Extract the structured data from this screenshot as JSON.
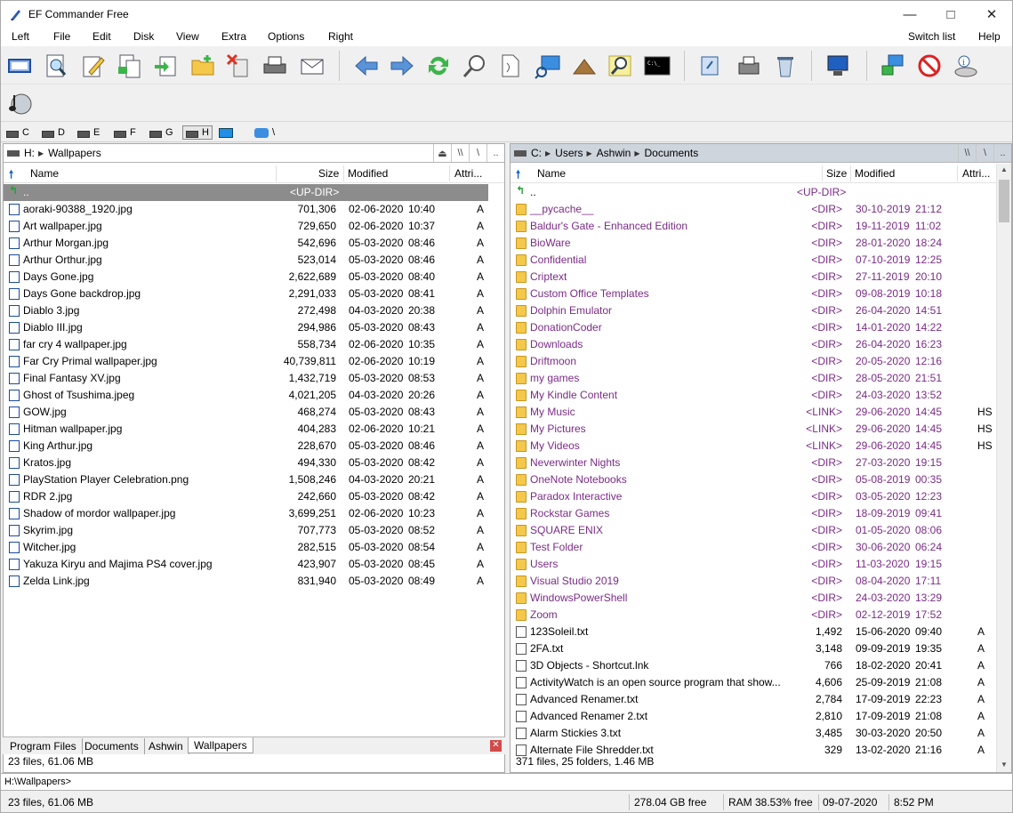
{
  "window": {
    "title": "EF Commander Free"
  },
  "menu": [
    "Left",
    "File",
    "Edit",
    "Disk",
    "View",
    "Extra",
    "Options",
    "Right",
    "Switch list",
    "Help"
  ],
  "toolbar_icons": [
    "panel-view-icon",
    "search-files-icon",
    "edit-icon",
    "copy-icon",
    "move-icon",
    "new-folder-icon",
    "delete-icon",
    "print-icon",
    "mail-icon",
    "back-icon",
    "forward-icon",
    "refresh-icon",
    "find-icon",
    "compare-icon",
    "remote-icon",
    "pyramid-icon",
    "search-icon",
    "terminal-icon",
    "notes-icon",
    "fax-icon",
    "recycle-bin-icon",
    "monitor-icon",
    "network-icon",
    "block-icon",
    "disk-info-icon",
    "music-player-icon"
  ],
  "drives": [
    {
      "letter": "C"
    },
    {
      "letter": "D"
    },
    {
      "letter": "E"
    },
    {
      "letter": "F"
    },
    {
      "letter": "G"
    },
    {
      "letter": "H"
    }
  ],
  "drive_extra": "\\",
  "left_pane": {
    "path": [
      "H:",
      "Wallpapers"
    ],
    "path_buttons": [
      "\\\\",
      "\\",
      ".."
    ],
    "columns": {
      "name": "Name",
      "size": "Size",
      "modified": "Modified",
      "attr": "Attri..."
    },
    "updir": {
      "name": "..",
      "size": "<UP-DIR>"
    },
    "rows": [
      {
        "name": "aoraki-90388_1920.jpg",
        "size": "701,306",
        "date": "02-06-2020",
        "time": "10:40",
        "attr": "A"
      },
      {
        "name": "Art wallpaper.jpg",
        "size": "729,650",
        "date": "02-06-2020",
        "time": "10:37",
        "attr": "A"
      },
      {
        "name": "Arthur Morgan.jpg",
        "size": "542,696",
        "date": "05-03-2020",
        "time": "08:46",
        "attr": "A"
      },
      {
        "name": "Arthur Orthur.jpg",
        "size": "523,014",
        "date": "05-03-2020",
        "time": "08:46",
        "attr": "A"
      },
      {
        "name": "Days Gone.jpg",
        "size": "2,622,689",
        "date": "05-03-2020",
        "time": "08:40",
        "attr": "A"
      },
      {
        "name": "Days Gone backdrop.jpg",
        "size": "2,291,033",
        "date": "05-03-2020",
        "time": "08:41",
        "attr": "A"
      },
      {
        "name": "Diablo 3.jpg",
        "size": "272,498",
        "date": "04-03-2020",
        "time": "20:38",
        "attr": "A"
      },
      {
        "name": "Diablo III.jpg",
        "size": "294,986",
        "date": "05-03-2020",
        "time": "08:43",
        "attr": "A"
      },
      {
        "name": "far cry 4 wallpaper.jpg",
        "size": "558,734",
        "date": "02-06-2020",
        "time": "10:35",
        "attr": "A"
      },
      {
        "name": "Far Cry Primal wallpaper.jpg",
        "size": "40,739,811",
        "date": "02-06-2020",
        "time": "10:19",
        "attr": "A"
      },
      {
        "name": "Final Fantasy XV.jpg",
        "size": "1,432,719",
        "date": "05-03-2020",
        "time": "08:53",
        "attr": "A"
      },
      {
        "name": "Ghost of Tsushima.jpeg",
        "size": "4,021,205",
        "date": "04-03-2020",
        "time": "20:26",
        "attr": "A"
      },
      {
        "name": "GOW.jpg",
        "size": "468,274",
        "date": "05-03-2020",
        "time": "08:43",
        "attr": "A"
      },
      {
        "name": "Hitman wallpaper.jpg",
        "size": "404,283",
        "date": "02-06-2020",
        "time": "10:21",
        "attr": "A"
      },
      {
        "name": "King Arthur.jpg",
        "size": "228,670",
        "date": "05-03-2020",
        "time": "08:46",
        "attr": "A"
      },
      {
        "name": "Kratos.jpg",
        "size": "494,330",
        "date": "05-03-2020",
        "time": "08:42",
        "attr": "A"
      },
      {
        "name": "PlayStation Player Celebration.png",
        "size": "1,508,246",
        "date": "04-03-2020",
        "time": "20:21",
        "attr": "A"
      },
      {
        "name": "RDR 2.jpg",
        "size": "242,660",
        "date": "05-03-2020",
        "time": "08:42",
        "attr": "A"
      },
      {
        "name": "Shadow of mordor wallpaper.jpg",
        "size": "3,699,251",
        "date": "02-06-2020",
        "time": "10:23",
        "attr": "A"
      },
      {
        "name": "Skyrim.jpg",
        "size": "707,773",
        "date": "05-03-2020",
        "time": "08:52",
        "attr": "A"
      },
      {
        "name": "Witcher.jpg",
        "size": "282,515",
        "date": "05-03-2020",
        "time": "08:54",
        "attr": "A"
      },
      {
        "name": "Yakuza Kiryu and Majima PS4 cover.jpg",
        "size": "423,907",
        "date": "05-03-2020",
        "time": "08:45",
        "attr": "A"
      },
      {
        "name": "Zelda Link.jpg",
        "size": "831,940",
        "date": "05-03-2020",
        "time": "08:49",
        "attr": "A"
      }
    ],
    "tabs": [
      "Program Files",
      "Documents",
      "Ashwin",
      "Wallpapers"
    ],
    "active_tab": "Wallpapers",
    "status": "23 files, 61.06 MB"
  },
  "right_pane": {
    "path": [
      "C:",
      "Users",
      "Ashwin",
      "Documents"
    ],
    "path_buttons": [
      "\\\\",
      "\\",
      ".."
    ],
    "columns": {
      "name": "Name",
      "size": "Size",
      "modified": "Modified",
      "attr": "Attri..."
    },
    "updir": {
      "name": "..",
      "size": "<UP-DIR>"
    },
    "rows": [
      {
        "type": "folder",
        "name": "__pycache__",
        "size": "<DIR>",
        "date": "30-10-2019",
        "time": "21:12",
        "attr": ""
      },
      {
        "type": "folder",
        "name": "Baldur's Gate - Enhanced Edition",
        "size": "<DIR>",
        "date": "19-11-2019",
        "time": "11:02",
        "attr": ""
      },
      {
        "type": "folder",
        "name": "BioWare",
        "size": "<DIR>",
        "date": "28-01-2020",
        "time": "18:24",
        "attr": ""
      },
      {
        "type": "folder",
        "name": "Confidential",
        "size": "<DIR>",
        "date": "07-10-2019",
        "time": "12:25",
        "attr": ""
      },
      {
        "type": "folder",
        "name": "Criptext",
        "size": "<DIR>",
        "date": "27-11-2019",
        "time": "20:10",
        "attr": ""
      },
      {
        "type": "folder",
        "name": "Custom Office Templates",
        "size": "<DIR>",
        "date": "09-08-2019",
        "time": "10:18",
        "attr": ""
      },
      {
        "type": "folder",
        "name": "Dolphin Emulator",
        "size": "<DIR>",
        "date": "26-04-2020",
        "time": "14:51",
        "attr": ""
      },
      {
        "type": "folder",
        "name": "DonationCoder",
        "size": "<DIR>",
        "date": "14-01-2020",
        "time": "14:22",
        "attr": ""
      },
      {
        "type": "folder",
        "name": "Downloads",
        "size": "<DIR>",
        "date": "26-04-2020",
        "time": "16:23",
        "attr": ""
      },
      {
        "type": "folder",
        "name": "Driftmoon",
        "size": "<DIR>",
        "date": "20-05-2020",
        "time": "12:16",
        "attr": ""
      },
      {
        "type": "folder",
        "name": "my games",
        "size": "<DIR>",
        "date": "28-05-2020",
        "time": "21:51",
        "attr": ""
      },
      {
        "type": "folder",
        "name": "My Kindle Content",
        "size": "<DIR>",
        "date": "24-03-2020",
        "time": "13:52",
        "attr": ""
      },
      {
        "type": "link",
        "name": "My Music",
        "size": "<LINK>",
        "date": "29-06-2020",
        "time": "14:45",
        "attr": "HS"
      },
      {
        "type": "link",
        "name": "My Pictures",
        "size": "<LINK>",
        "date": "29-06-2020",
        "time": "14:45",
        "attr": "HS"
      },
      {
        "type": "link",
        "name": "My Videos",
        "size": "<LINK>",
        "date": "29-06-2020",
        "time": "14:45",
        "attr": "HS"
      },
      {
        "type": "folder",
        "name": "Neverwinter Nights",
        "size": "<DIR>",
        "date": "27-03-2020",
        "time": "19:15",
        "attr": ""
      },
      {
        "type": "folder",
        "name": "OneNote Notebooks",
        "size": "<DIR>",
        "date": "05-08-2019",
        "time": "00:35",
        "attr": ""
      },
      {
        "type": "folder",
        "name": "Paradox Interactive",
        "size": "<DIR>",
        "date": "03-05-2020",
        "time": "12:23",
        "attr": ""
      },
      {
        "type": "folder",
        "name": "Rockstar Games",
        "size": "<DIR>",
        "date": "18-09-2019",
        "time": "09:41",
        "attr": ""
      },
      {
        "type": "folder",
        "name": "SQUARE ENIX",
        "size": "<DIR>",
        "date": "01-05-2020",
        "time": "08:06",
        "attr": ""
      },
      {
        "type": "folder",
        "name": "Test Folder",
        "size": "<DIR>",
        "date": "30-06-2020",
        "time": "06:24",
        "attr": ""
      },
      {
        "type": "folder",
        "name": "Users",
        "size": "<DIR>",
        "date": "11-03-2020",
        "time": "19:15",
        "attr": ""
      },
      {
        "type": "folder",
        "name": "Visual Studio 2019",
        "size": "<DIR>",
        "date": "08-04-2020",
        "time": "17:11",
        "attr": ""
      },
      {
        "type": "folder",
        "name": "WindowsPowerShell",
        "size": "<DIR>",
        "date": "24-03-2020",
        "time": "13:29",
        "attr": ""
      },
      {
        "type": "folder",
        "name": "Zoom",
        "size": "<DIR>",
        "date": "02-12-2019",
        "time": "17:52",
        "attr": ""
      },
      {
        "type": "file",
        "name": "123Soleil.txt",
        "size": "1,492",
        "date": "15-06-2020",
        "time": "09:40",
        "attr": "A"
      },
      {
        "type": "file",
        "name": "2FA.txt",
        "size": "3,148",
        "date": "09-09-2019",
        "time": "19:35",
        "attr": "A"
      },
      {
        "type": "file",
        "name": "3D Objects - Shortcut.lnk",
        "size": "766",
        "date": "18-02-2020",
        "time": "20:41",
        "attr": "A"
      },
      {
        "type": "file",
        "name": "ActivityWatch is an open source program that show...",
        "size": "4,606",
        "date": "25-09-2019",
        "time": "21:08",
        "attr": "A"
      },
      {
        "type": "file",
        "name": "Advanced Renamer.txt",
        "size": "2,784",
        "date": "17-09-2019",
        "time": "22:23",
        "attr": "A"
      },
      {
        "type": "file",
        "name": "Advanced Renamer 2.txt",
        "size": "2,810",
        "date": "17-09-2019",
        "time": "21:08",
        "attr": "A"
      },
      {
        "type": "file",
        "name": "Alarm Stickies 3.txt",
        "size": "3,485",
        "date": "30-03-2020",
        "time": "20:50",
        "attr": "A"
      },
      {
        "type": "file",
        "name": "Alternate File Shredder.txt",
        "size": "329",
        "date": "13-02-2020",
        "time": "21:16",
        "attr": "A"
      }
    ],
    "status": "371 files, 25 folders, 1.46 MB"
  },
  "command_line": {
    "prompt": "H:\\Wallpapers>"
  },
  "statusbar": {
    "left": "23 files, 61.06 MB",
    "free": "278.04 GB free",
    "ram": "RAM 38.53% free",
    "date": "09-07-2020",
    "time": "8:52 PM"
  },
  "colors": {
    "folder_text": "#7a2b86",
    "updir_bg": "#8c8c8c",
    "active_path_bg": "#cfd5dd"
  }
}
